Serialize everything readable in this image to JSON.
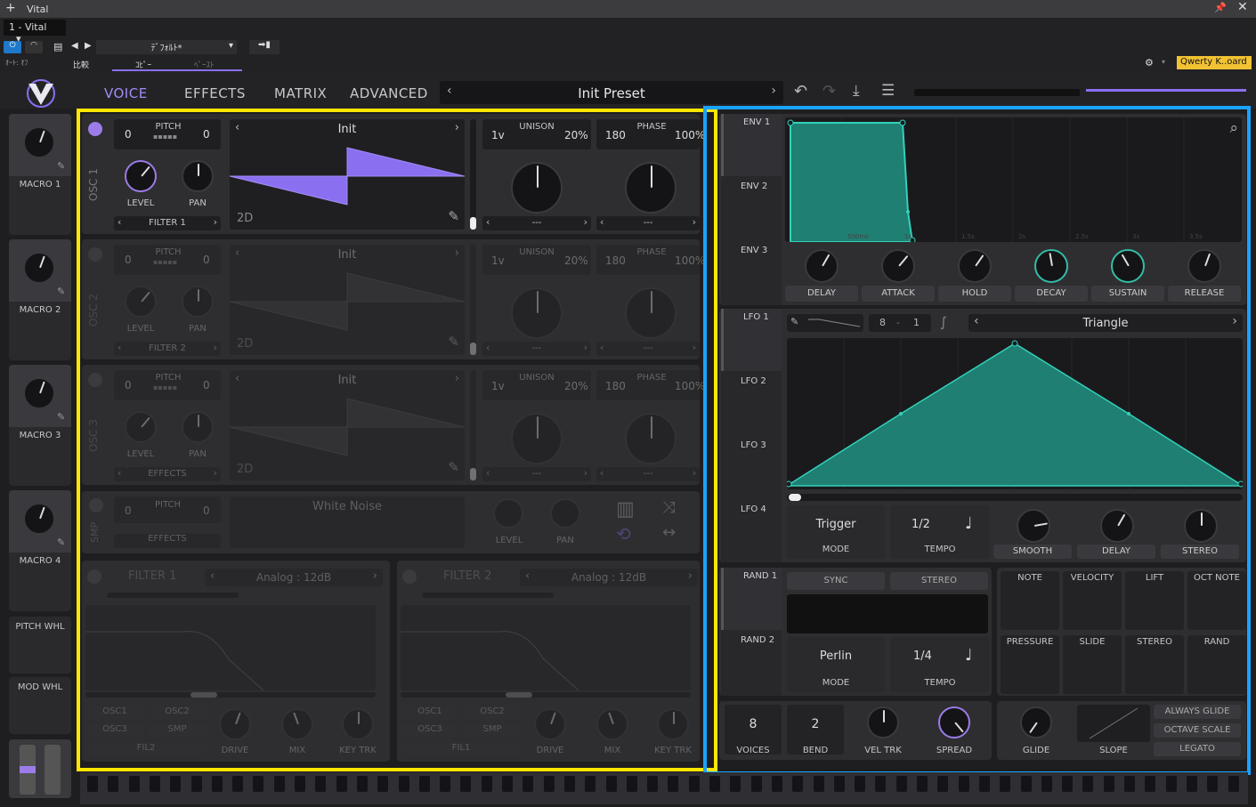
{
  "host": {
    "window_title": "Vital",
    "instance": "1 - Vital",
    "auto_off": "ｵｰﾄ: ｵﾌ",
    "preset_default": "ﾃﾞﾌｫﾙﾄ*",
    "compare": "比較",
    "copy": "ｺﾋﾟｰ",
    "paste": "ﾍﾟｰｽﾄ",
    "keyboard": "Qwerty K..oard"
  },
  "tabs": [
    "VOICE",
    "EFFECTS",
    "MATRIX",
    "ADVANCED"
  ],
  "preset_name": "Init Preset",
  "macros": [
    "MACRO 1",
    "MACRO 2",
    "MACRO 3",
    "MACRO 4"
  ],
  "wheels": [
    "PITCH WHL",
    "MOD WHL"
  ],
  "osc": [
    {
      "name": "OSC 1",
      "pitch_label": "PITCH",
      "pitch_left": "0",
      "pitch_right": "0",
      "level": "LEVEL",
      "pan": "PAN",
      "dest": "FILTER 1",
      "wavetable": "Init",
      "mode": "2D",
      "unison_voices": "1v",
      "unison": "UNISON",
      "unison_pct": "20%",
      "phase_val": "180",
      "phase": "PHASE",
      "phase_pct": "100%",
      "sel1": "---",
      "sel2": "---"
    },
    {
      "name": "OSC 2",
      "pitch_label": "PITCH",
      "pitch_left": "0",
      "pitch_right": "0",
      "level": "LEVEL",
      "pan": "PAN",
      "dest": "FILTER 2",
      "wavetable": "Init",
      "mode": "2D",
      "unison_voices": "1v",
      "unison": "UNISON",
      "unison_pct": "20%",
      "phase_val": "180",
      "phase": "PHASE",
      "phase_pct": "100%",
      "sel1": "---",
      "sel2": "---"
    },
    {
      "name": "OSC 3",
      "pitch_label": "PITCH",
      "pitch_left": "0",
      "pitch_right": "0",
      "level": "LEVEL",
      "pan": "PAN",
      "dest": "EFFECTS",
      "wavetable": "Init",
      "mode": "2D",
      "unison_voices": "1v",
      "unison": "UNISON",
      "unison_pct": "20%",
      "phase_val": "180",
      "phase": "PHASE",
      "phase_pct": "100%",
      "sel1": "---",
      "sel2": "---"
    }
  ],
  "smp": {
    "name": "SMP",
    "pitch_label": "PITCH",
    "pitch_left": "0",
    "pitch_right": "0",
    "dest": "EFFECTS",
    "sample": "White Noise",
    "level": "LEVEL",
    "pan": "PAN"
  },
  "filters": [
    {
      "name": "FILTER 1",
      "model": "Analog : 12dB",
      "src": [
        "OSC1",
        "OSC2",
        "OSC3",
        "SMP",
        "FIL2"
      ],
      "drive": "DRIVE",
      "mix": "MIX",
      "key_trk": "KEY TRK"
    },
    {
      "name": "FILTER 2",
      "model": "Analog : 12dB",
      "src": [
        "OSC1",
        "OSC2",
        "OSC3",
        "SMP",
        "FIL1"
      ],
      "drive": "DRIVE",
      "mix": "MIX",
      "key_trk": "KEY TRK"
    }
  ],
  "env": {
    "tabs": [
      "ENV 1",
      "ENV 2",
      "ENV 3"
    ],
    "time_labels": [
      "500ms",
      "1s",
      "1.5s",
      "2s",
      "2.5s",
      "3s",
      "3.5s"
    ],
    "knobs": [
      "DELAY",
      "ATTACK",
      "HOLD",
      "DECAY",
      "SUSTAIN",
      "RELEASE"
    ]
  },
  "lfo": {
    "tabs": [
      "LFO 1",
      "LFO 2",
      "LFO 3",
      "LFO 4"
    ],
    "grid_a": "8",
    "grid_dash": "-",
    "grid_b": "1",
    "shape": "Triangle",
    "mode_val": "Trigger",
    "mode": "MODE",
    "tempo_val": "1/2",
    "tempo": "TEMPO",
    "knobs": [
      "SMOOTH",
      "DELAY",
      "STEREO"
    ]
  },
  "rand": {
    "tabs": [
      "RAND 1",
      "RAND 2"
    ],
    "sync": "SYNC",
    "stereo": "STEREO",
    "mode_val": "Perlin",
    "mode": "MODE",
    "tempo_val": "1/4",
    "tempo": "TEMPO"
  },
  "mod_sources": [
    "NOTE",
    "VELOCITY",
    "LIFT",
    "OCT NOTE",
    "PRESSURE",
    "SLIDE",
    "STEREO",
    "RAND"
  ],
  "voice": {
    "voices_val": "8",
    "voices": "VOICES",
    "bend_val": "2",
    "bend": "BEND",
    "vel_trk": "VEL TRK",
    "spread": "SPREAD",
    "glide": "GLIDE",
    "slope": "SLOPE",
    "always_glide": "ALWAYS GLIDE",
    "octave_scale": "OCTAVE SCALE",
    "legato": "LEGATO"
  },
  "colors": {
    "accent": "#9b7ce8",
    "teal": "#33bba6",
    "highlight_yellow": "#ffe600",
    "highlight_blue": "#1aa3ff"
  }
}
